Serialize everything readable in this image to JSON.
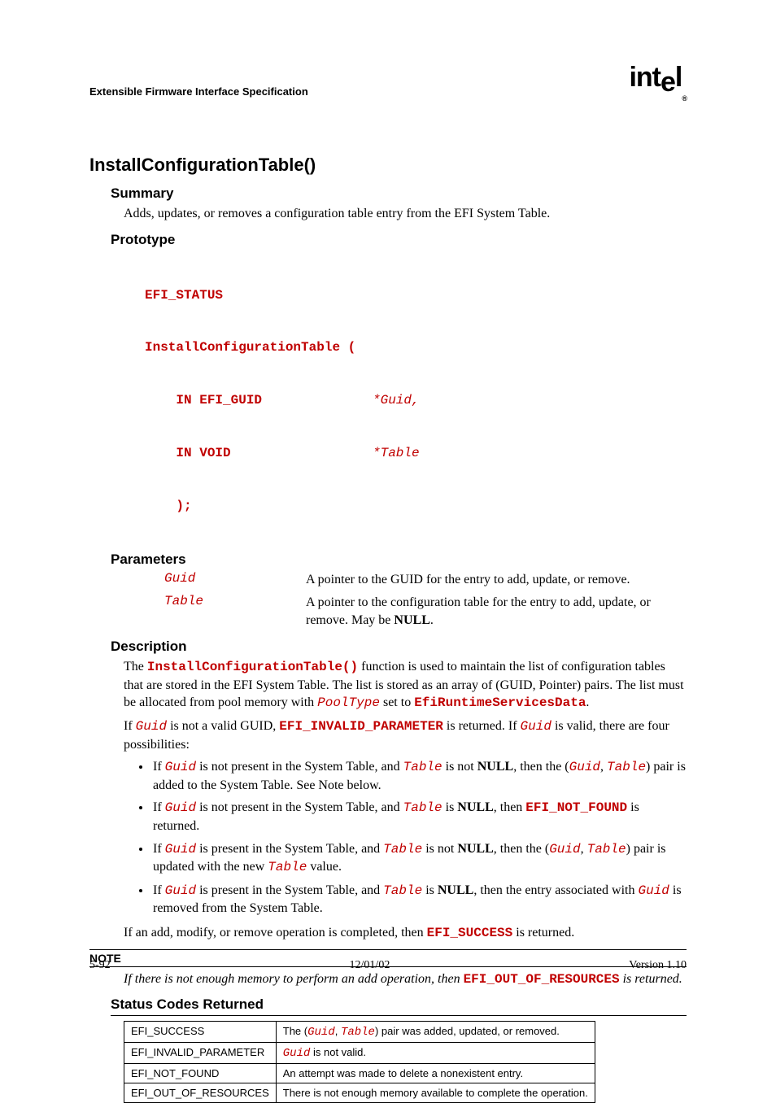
{
  "header": {
    "doc_title": "Extensible Firmware Interface Specification",
    "logo_text": "intel"
  },
  "title": "InstallConfigurationTable()",
  "summary": {
    "heading": "Summary",
    "text": "Adds, updates, or removes a configuration table entry from the EFI System Table."
  },
  "prototype": {
    "heading": "Prototype",
    "line1": "EFI_STATUS",
    "line2": "InstallConfigurationTable (",
    "row1_left": "    IN EFI_GUID",
    "row1_right": "*Guid,",
    "row2_left": "    IN VOID",
    "row2_right": "*Table",
    "line5": "    );"
  },
  "parameters": {
    "heading": "Parameters",
    "rows": [
      {
        "name": "Guid",
        "desc": "A pointer to the GUID for the entry to add, update, or remove."
      },
      {
        "name": "Table",
        "desc_pre": "A pointer to the configuration table for the entry to add, update, or remove.  May be ",
        "desc_bold": "NULL",
        "desc_post": "."
      }
    ]
  },
  "description": {
    "heading": "Description",
    "p1": {
      "t1": "The ",
      "c1": "InstallConfigurationTable()",
      "t2": " function is used to maintain the list of configuration tables that are stored in the EFI System Table.  The list is stored as an array of (GUID, Pointer) pairs.  The list must be allocated from pool memory with ",
      "c2": "PoolType",
      "t3": " set to ",
      "c3": "EfiRuntimeServicesData",
      "t4": "."
    },
    "p2": {
      "t1": "If ",
      "c1": "Guid",
      "t2": " is not a valid GUID, ",
      "c2": "EFI_INVALID_PARAMETER",
      "t3": " is returned.  If ",
      "c3": "Guid",
      "t4": " is valid, there are four possibilities:"
    },
    "bullets": [
      {
        "t1": "If ",
        "c1": "Guid",
        "t2": " is not present in the System Table, and ",
        "c2": "Table",
        "t3": " is not ",
        "b1": "NULL",
        "t4": ", then the (",
        "c3": "Guid",
        "t5": ", ",
        "c4": "Table",
        "t6": ") pair is added to the System Table.  See Note below."
      },
      {
        "t1": "If ",
        "c1": "Guid",
        "t2": " is not present in the System Table, and ",
        "c2": "Table",
        "t3": " is ",
        "b1": "NULL",
        "t4": ", then ",
        "c3": "EFI_NOT_FOUND",
        "t5": " is returned."
      },
      {
        "t1": "If ",
        "c1": "Guid",
        "t2": " is present in the System Table, and ",
        "c2": "Table",
        "t3": " is not ",
        "b1": "NULL",
        "t4": ", then the (",
        "c3": "Guid",
        "t5": ", ",
        "c4": "Table",
        "t6": ") pair is updated with the new ",
        "c5": "Table",
        "t7": " value."
      },
      {
        "t1": "If ",
        "c1": "Guid",
        "t2": " is present in the System Table, and ",
        "c2": "Table",
        "t3": " is ",
        "b1": "NULL",
        "t4": ", then the entry associated with ",
        "c3": "Guid",
        "t5": " is removed from the System Table."
      }
    ],
    "p3": {
      "t1": "If an add, modify, or remove operation is completed, then ",
      "c1": "EFI_SUCCESS",
      "t2": " is returned."
    }
  },
  "note": {
    "heading": "NOTE",
    "t1": "If there is not enough memory to perform an add operation, then ",
    "c1": "EFI_OUT_OF_RESOURCES",
    "t2": " is returned."
  },
  "status": {
    "heading": "Status Codes Returned",
    "rows": [
      {
        "code": "EFI_SUCCESS",
        "desc_pre": "The (",
        "c1": "Guid",
        "desc_mid": ", ",
        "c2": "Table",
        "desc_post": ") pair was added, updated, or removed."
      },
      {
        "code": "EFI_INVALID_PARAMETER",
        "c1": "Guid",
        "desc_post": " is not valid."
      },
      {
        "code": "EFI_NOT_FOUND",
        "desc": "An attempt was made to delete a nonexistent entry."
      },
      {
        "code": "EFI_OUT_OF_RESOURCES",
        "desc": "There is not enough memory available to complete the operation."
      }
    ]
  },
  "footer": {
    "left": "5-92",
    "center": "12/01/02",
    "right": "Version 1.10"
  }
}
